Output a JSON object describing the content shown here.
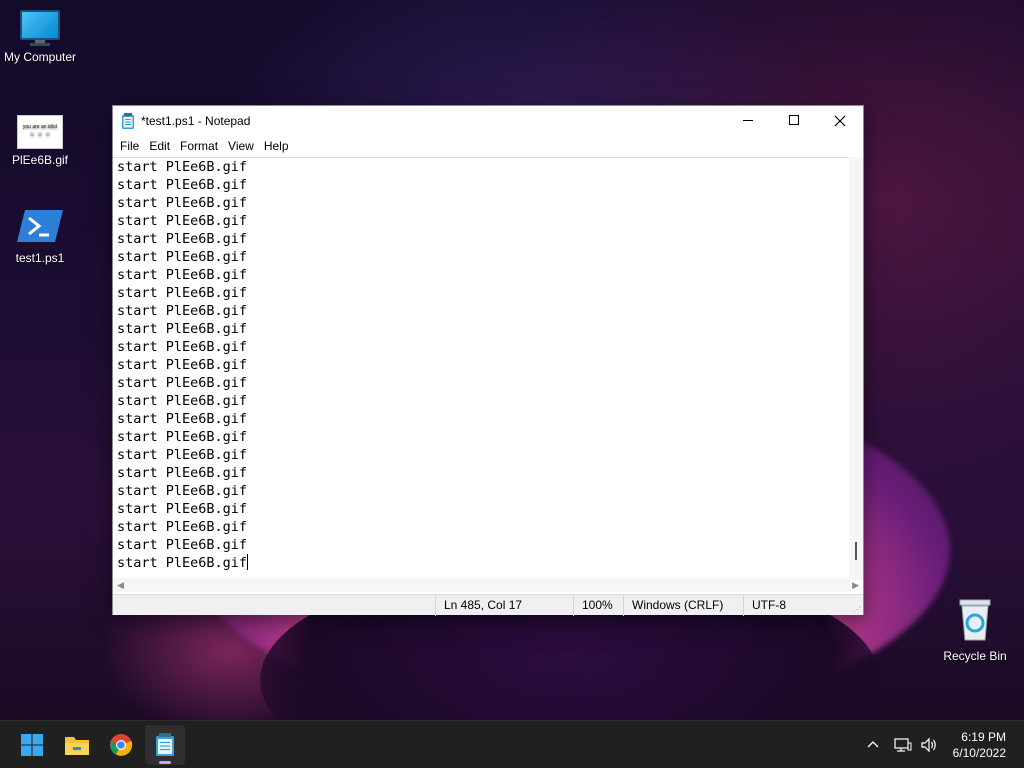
{
  "desktop": {
    "icons": [
      {
        "label": "My Computer",
        "icon": "monitor-icon"
      },
      {
        "label": "PlEe6B.gif",
        "icon": "gif-file-icon",
        "thumb_text": "you are an idiot"
      },
      {
        "label": "test1.ps1",
        "icon": "powershell-icon"
      },
      {
        "label": "Recycle Bin",
        "icon": "recycle-bin-icon"
      }
    ]
  },
  "notepad": {
    "title": "*test1.ps1 - Notepad",
    "menu": [
      "File",
      "Edit",
      "Format",
      "View",
      "Help"
    ],
    "lines": [
      "start PlEe6B.gif",
      "start PlEe6B.gif",
      "start PlEe6B.gif",
      "start PlEe6B.gif",
      "start PlEe6B.gif",
      "start PlEe6B.gif",
      "start PlEe6B.gif",
      "start PlEe6B.gif",
      "start PlEe6B.gif",
      "start PlEe6B.gif",
      "start PlEe6B.gif",
      "start PlEe6B.gif",
      "start PlEe6B.gif",
      "start PlEe6B.gif",
      "start PlEe6B.gif",
      "start PlEe6B.gif",
      "start PlEe6B.gif",
      "start PlEe6B.gif",
      "start PlEe6B.gif",
      "start PlEe6B.gif",
      "start PlEe6B.gif",
      "start PlEe6B.gif",
      "start PlEe6B.gif"
    ],
    "status": {
      "position": "Ln 485, Col 17",
      "zoom": "100%",
      "line_endings": "Windows (CRLF)",
      "encoding": "UTF-8"
    }
  },
  "taskbar": {
    "apps": [
      "start-icon",
      "file-explorer-icon",
      "chrome-icon",
      "notepad-icon"
    ],
    "active_app": "notepad-icon",
    "clock": {
      "time": "6:19 PM",
      "date": "6/10/2022"
    }
  },
  "colors": {
    "taskbar_bg": "#202020",
    "accent": "#c7a4e6",
    "window_bg": "#ffffff"
  }
}
